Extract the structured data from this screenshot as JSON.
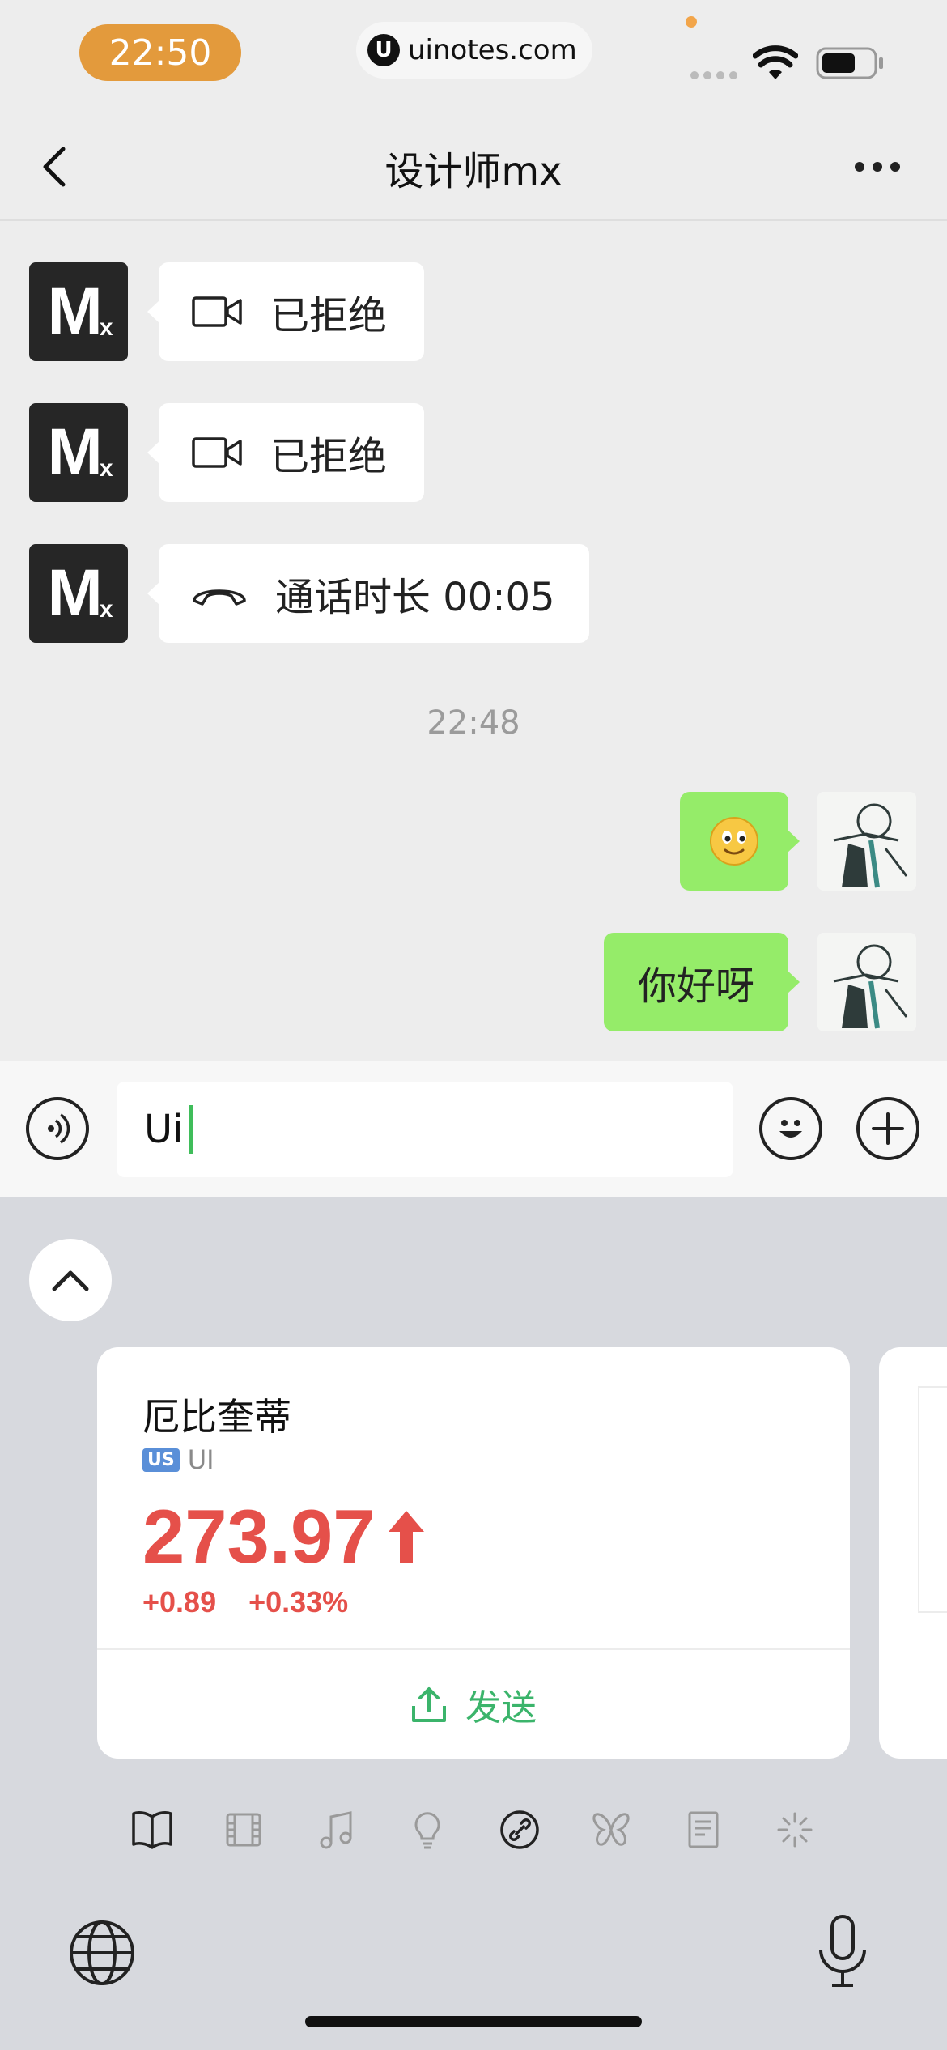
{
  "status_bar": {
    "time": "22:50",
    "url": "uinotes.com",
    "url_logo": "U"
  },
  "nav": {
    "title": "设计师mx",
    "back_icon": "chevron-left-icon",
    "more_icon": "more-dots-icon"
  },
  "messages": [
    {
      "side": "left",
      "sender_avatar": "Mx",
      "icon": "video-camera-icon",
      "text": "已拒绝"
    },
    {
      "side": "left",
      "sender_avatar": "Mx",
      "icon": "video-camera-icon",
      "text": "已拒绝"
    },
    {
      "side": "left",
      "sender_avatar": "Mx",
      "icon": "phone-hangup-icon",
      "text": "通话时长 00:05"
    },
    {
      "side": "right",
      "type": "emoji",
      "text": "🙂"
    },
    {
      "side": "right",
      "type": "text",
      "text": "你好呀"
    }
  ],
  "timestamp": "22:48",
  "input": {
    "value": "Ui"
  },
  "stock_card": {
    "name": "厄比奎蒂",
    "market": "US",
    "ticker": "UI",
    "price": "273.97",
    "change": "+0.89",
    "change_pct": "+0.33%",
    "send_label": "发送",
    "color_up": "#e5504a"
  },
  "colors": {
    "bubble_green": "#95ec69",
    "send_green": "#3bb46b",
    "time_pill": "#e39a3c"
  },
  "category_tabs": [
    "book-icon",
    "film-icon",
    "music-icon",
    "lightbulb-icon",
    "link-icon",
    "butterfly-icon",
    "document-icon",
    "spinner-icon"
  ]
}
